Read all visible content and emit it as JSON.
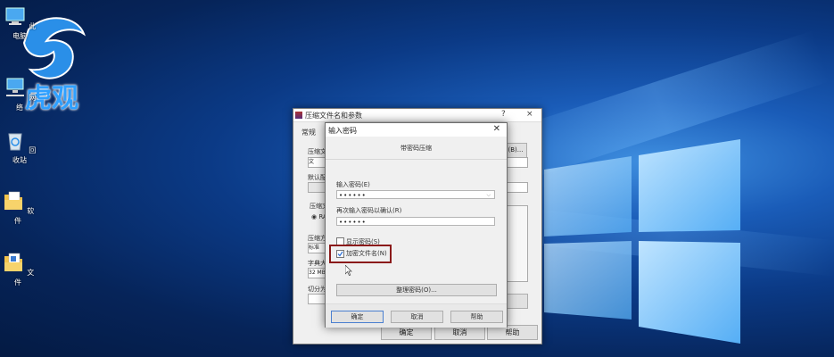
{
  "desktop": {
    "icons": [
      {
        "label": "此电脑",
        "icon": "computer-icon"
      },
      {
        "label": "网络",
        "icon": "network-icon"
      },
      {
        "label": "回收站",
        "icon": "recycle-bin-icon"
      },
      {
        "label": "软件",
        "icon": "folder-icon"
      },
      {
        "label": "文件",
        "icon": "folder-icon"
      }
    ],
    "watermark": "虎观"
  },
  "back_dialog": {
    "title": "压缩文件名和参数",
    "help_glyph": "?",
    "close_glyph": "×",
    "tab_general": "常规",
    "label_archive": "压缩文",
    "field_archive": "文件.ra",
    "label_config": "默认配",
    "label_format": "压缩文",
    "radio_format": "RA",
    "label_method": "压缩方",
    "field_method": "标准",
    "label_dict": "字典大",
    "field_dict": "32 MB",
    "label_split": "切分为",
    "browse_suffix": "(B)...",
    "ok": "确定",
    "cancel": "取消",
    "help": "帮助"
  },
  "password_dialog": {
    "title": "输入密码",
    "close_glyph": "✕",
    "subtitle": "带密码压缩",
    "label_password": "输入密码(E)",
    "password_value": "••••••",
    "label_confirm": "再次输入密码以确认(R)",
    "confirm_value": "••••••",
    "show_password": "显示密码(S)",
    "show_password_checked": false,
    "encrypt_names": "加密文件名(N)",
    "encrypt_names_checked": true,
    "organize": "整理密码(O)...",
    "ok": "确定",
    "cancel": "取消",
    "help": "帮助"
  },
  "colors": {
    "highlight_border": "#8b1a1a",
    "watermark": "#2fa0ff"
  }
}
